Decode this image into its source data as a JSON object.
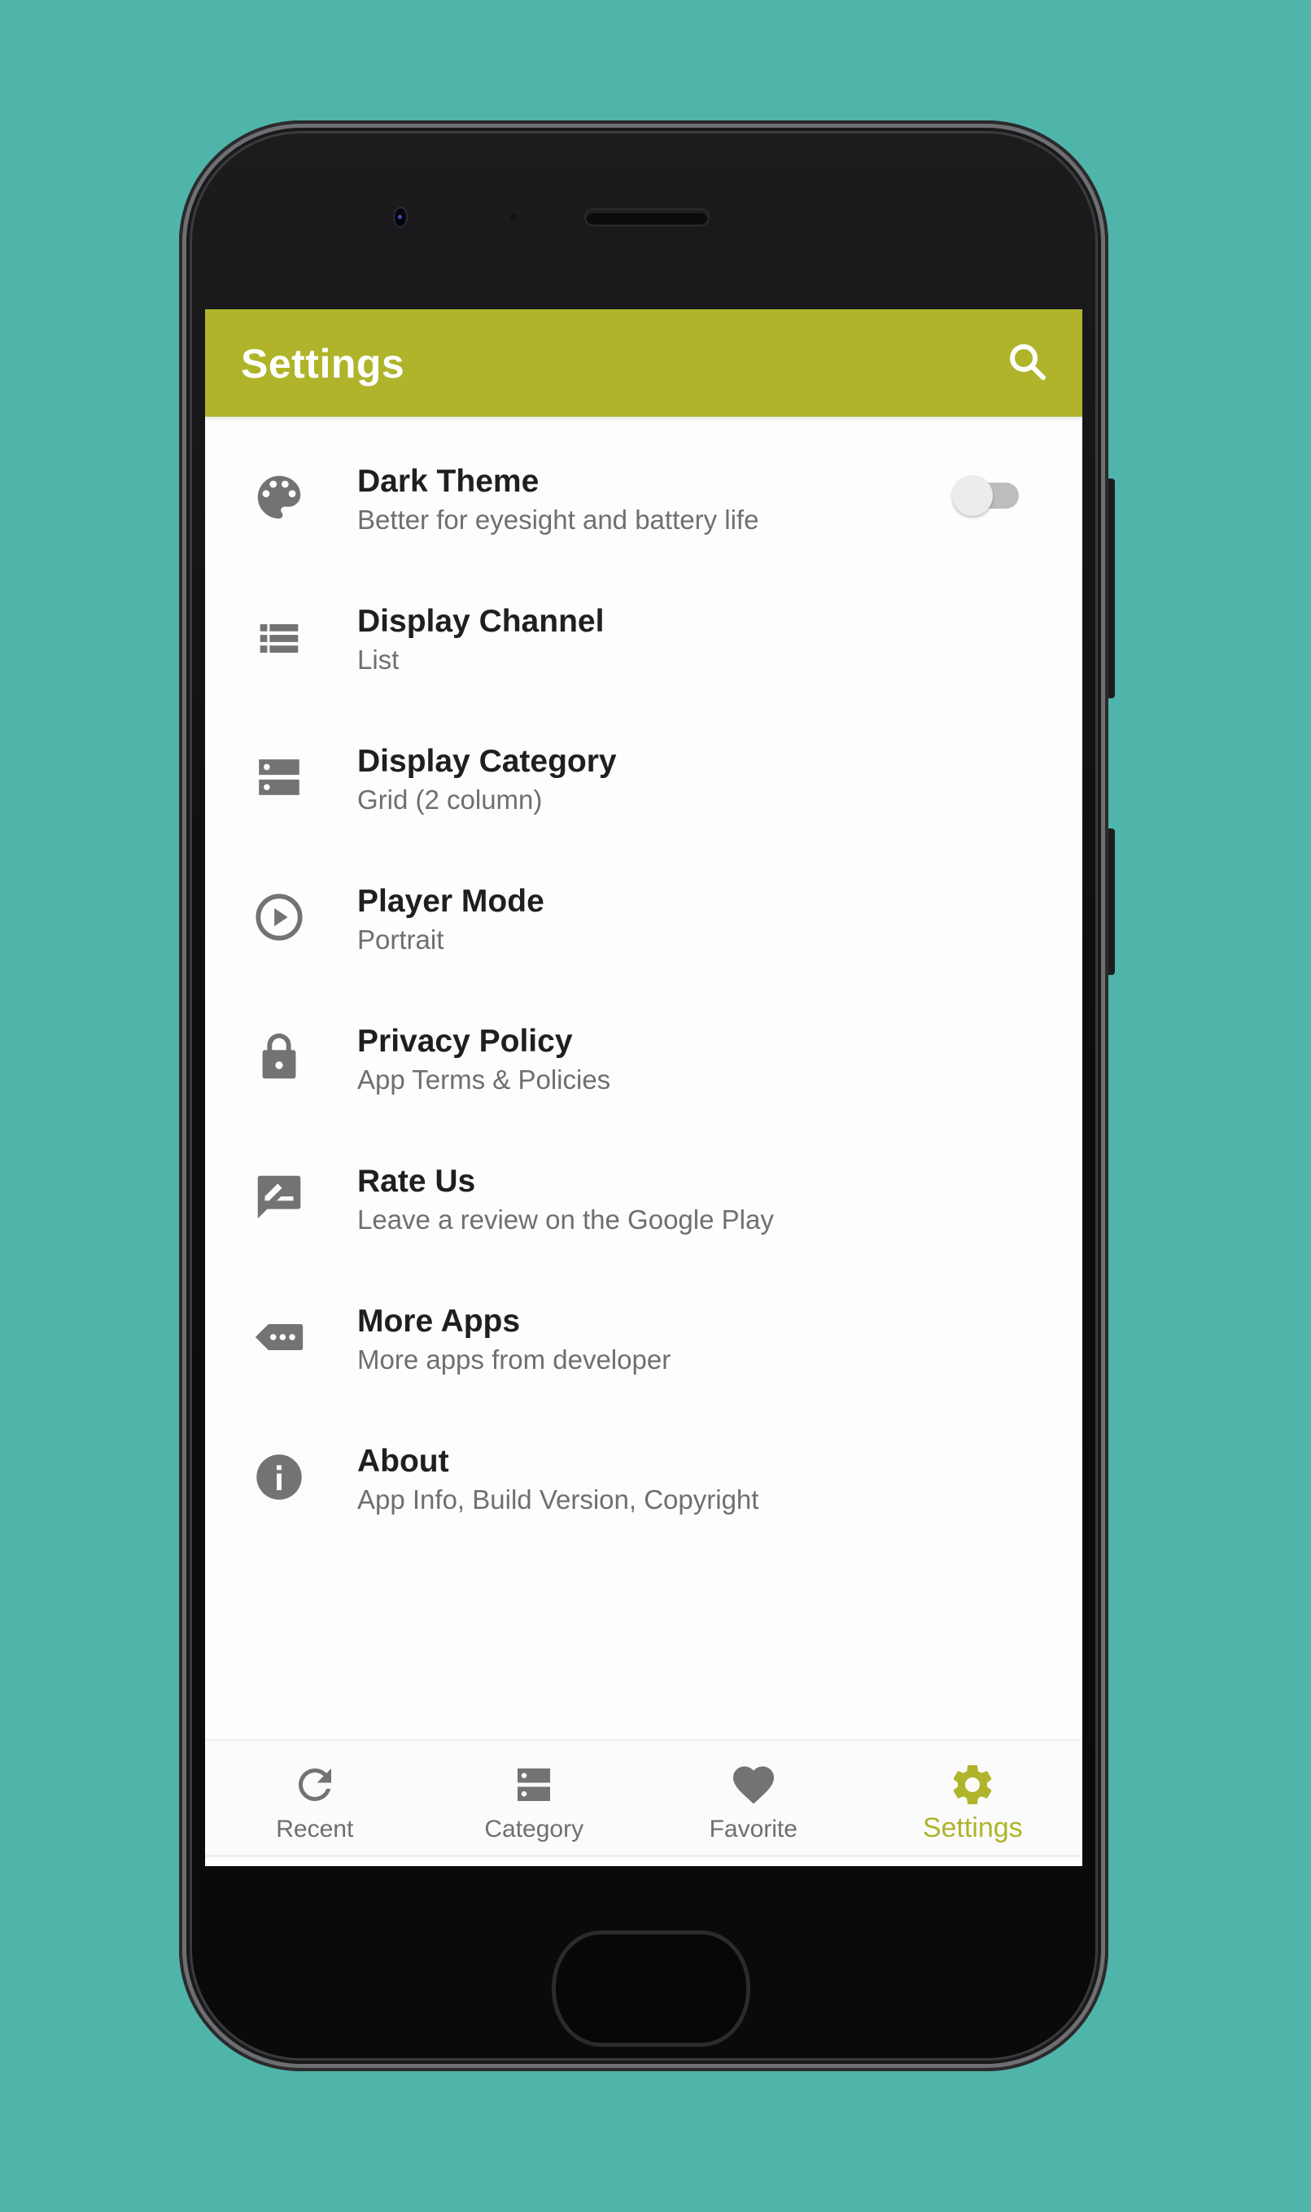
{
  "colors": {
    "background": "#4fb5aa",
    "accent": "#afb42b",
    "icon_gray": "#737373",
    "title_text": "#1f1f1f",
    "subtitle_text": "#6f6f6f"
  },
  "appbar": {
    "title": "Settings",
    "search_icon": "search-icon"
  },
  "settings": {
    "items": [
      {
        "icon": "palette-icon",
        "title": "Dark Theme",
        "subtitle": "Better for eyesight and battery life",
        "toggle": {
          "on": false
        }
      },
      {
        "icon": "list-icon",
        "title": "Display Channel",
        "subtitle": "List"
      },
      {
        "icon": "grid-icon",
        "title": "Display Category",
        "subtitle": "Grid (2 column)"
      },
      {
        "icon": "play-circle-icon",
        "title": "Player Mode",
        "subtitle": "Portrait"
      },
      {
        "icon": "lock-icon",
        "title": "Privacy Policy",
        "subtitle": "App Terms & Policies"
      },
      {
        "icon": "rate-review-icon",
        "title": "Rate Us",
        "subtitle": "Leave a review on the Google Play"
      },
      {
        "icon": "more-apps-icon",
        "title": "More Apps",
        "subtitle": "More apps from developer"
      },
      {
        "icon": "info-icon",
        "title": "About",
        "subtitle": "App Info, Build Version, Copyright"
      }
    ]
  },
  "bottom_nav": {
    "active_index": 3,
    "items": [
      {
        "icon": "refresh-icon",
        "label": "Recent"
      },
      {
        "icon": "category-icon",
        "label": "Category"
      },
      {
        "icon": "heart-icon",
        "label": "Favorite"
      },
      {
        "icon": "gear-icon",
        "label": "Settings"
      }
    ]
  }
}
